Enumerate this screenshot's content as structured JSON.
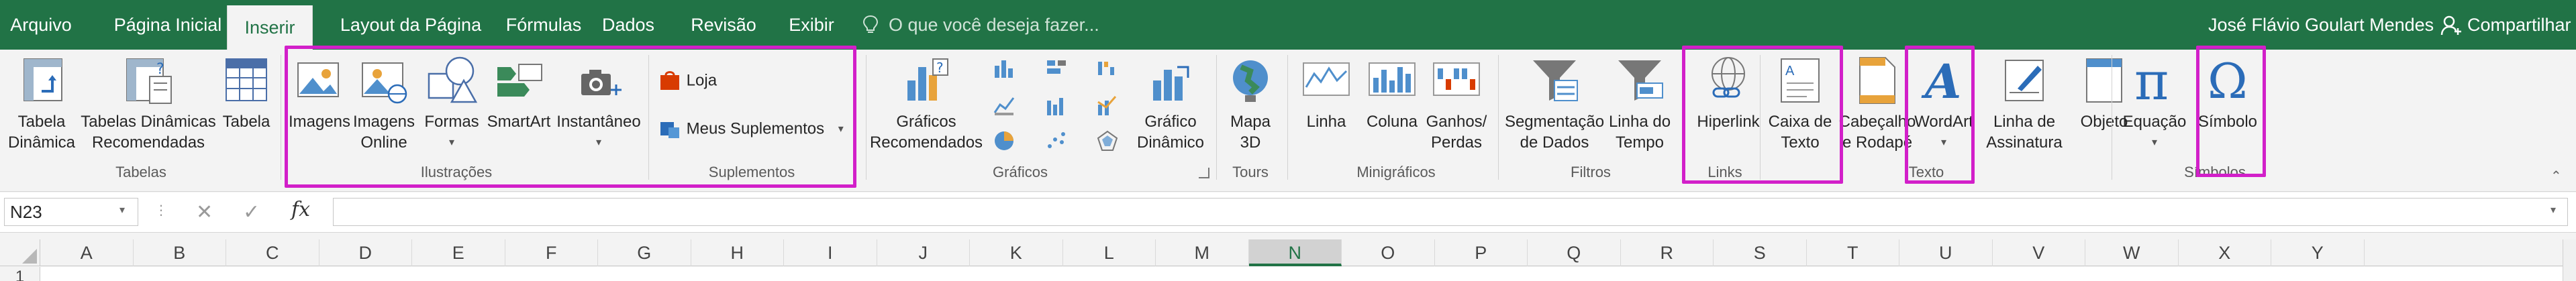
{
  "tabs": [
    {
      "label": "Arquivo",
      "active": false
    },
    {
      "label": "Página Inicial",
      "active": false
    },
    {
      "label": "Inserir",
      "active": true
    },
    {
      "label": "Layout da Página",
      "active": false
    },
    {
      "label": "Fórmulas",
      "active": false
    },
    {
      "label": "Dados",
      "active": false
    },
    {
      "label": "Revisão",
      "active": false
    },
    {
      "label": "Exibir",
      "active": false
    }
  ],
  "tellme": {
    "placeholder": "O que você deseja fazer..."
  },
  "user": {
    "name": "José Flávio Goulart Mendes"
  },
  "share": {
    "label": "Compartilhar"
  },
  "ribbon": {
    "tabelas": {
      "group_label": "Tabelas",
      "tabela_dinamica": "Tabela\nDinâmica",
      "tabelas_recomendadas": "Tabelas Dinâmicas\nRecomendadas",
      "tabela": "Tabela"
    },
    "ilustracoes": {
      "group_label": "Ilustrações",
      "imagens": "Imagens",
      "imagens_online": "Imagens\nOnline",
      "formas": "Formas",
      "smartart": "SmartArt",
      "instantaneo": "Instantâneo"
    },
    "suplementos": {
      "group_label": "Suplementos",
      "loja": "Loja",
      "meus_suplementos": "Meus Suplementos"
    },
    "graficos": {
      "group_label": "Gráficos",
      "recomendados": "Gráficos\nRecomendados",
      "grafico_dinamico": "Gráfico\nDinâmico"
    },
    "tours": {
      "group_label": "Tours",
      "mapa3d": "Mapa\n3D"
    },
    "minigraficos": {
      "group_label": "Minigráficos",
      "linha": "Linha",
      "coluna": "Coluna",
      "ganhos_perdas": "Ganhos/\nPerdas"
    },
    "filtros": {
      "group_label": "Filtros",
      "segmentacao": "Segmentação\nde Dados",
      "linha_tempo": "Linha do\nTempo"
    },
    "links": {
      "group_label": "Links",
      "hiperlink": "Hiperlink"
    },
    "texto": {
      "group_label": "Texto",
      "caixa_texto": "Caixa de\nTexto",
      "cabecalho": "Cabeçalho\ne Rodapé",
      "wordart": "WordArt",
      "assinatura": "Linha de\nAssinatura",
      "objeto": "Objeto"
    },
    "simbolos": {
      "group_label": "Símbolos",
      "equacao": "Equação",
      "simbolo": "Símbolo"
    }
  },
  "formula_bar": {
    "name_box": "N23",
    "cancel_glyph": "✕",
    "enter_glyph": "✓",
    "fx_label": "fx",
    "formula": ""
  },
  "grid": {
    "columns": [
      "A",
      "B",
      "C",
      "D",
      "E",
      "F",
      "G",
      "H",
      "I",
      "J",
      "K",
      "L",
      "M",
      "N",
      "O",
      "P",
      "Q",
      "R",
      "S",
      "T",
      "U",
      "V",
      "W",
      "X",
      "Y"
    ],
    "selected_column": "N",
    "first_row": "1"
  },
  "colors": {
    "excel_green": "#217346",
    "highlight_magenta": "#d21fc9"
  }
}
